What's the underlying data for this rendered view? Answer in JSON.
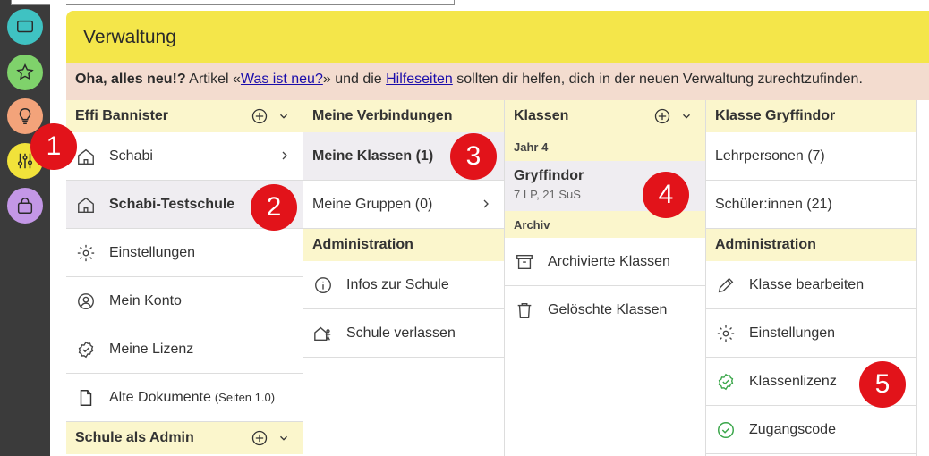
{
  "header": {
    "title": "Verwaltung"
  },
  "notice": {
    "lead": "Oha, alles neu!?",
    "t1": " Artikel «",
    "link1": "Was ist neu?",
    "t2": "» und die ",
    "link2": "Hilfeseiten",
    "t3": " sollten dir helfen, dich in der neuen Verwaltung zurechtzufinden."
  },
  "col1": {
    "title": "Effi Bannister",
    "items": [
      {
        "label": "Schabi"
      },
      {
        "label": "Schabi-Testschule"
      },
      {
        "label": "Einstellungen"
      },
      {
        "label": "Mein Konto"
      },
      {
        "label": "Meine Lizenz"
      },
      {
        "label": "Alte Dokumente",
        "suffix": "(Seiten 1.0)"
      }
    ],
    "footer_title": "Schule als Admin"
  },
  "col2": {
    "title": "Meine Verbindungen",
    "items": [
      {
        "label": "Meine Klassen (1)"
      },
      {
        "label": "Meine Gruppen (0)"
      }
    ],
    "admin_title": "Administration",
    "admin_items": [
      {
        "label": "Infos zur Schule"
      },
      {
        "label": "Schule verlassen"
      }
    ]
  },
  "col3": {
    "title": "Klassen",
    "year_label": "Jahr 4",
    "class_name": "Gryffindor",
    "class_meta": "7 LP, 21 SuS",
    "archive_label": "Archiv",
    "archive_items": [
      {
        "label": "Archivierte Klassen"
      },
      {
        "label": "Gelöschte Klassen"
      }
    ]
  },
  "col4": {
    "title": "Klasse Gryffindor",
    "items": [
      {
        "label": "Lehrpersonen (7)"
      },
      {
        "label": "Schüler:innen (21)"
      }
    ],
    "admin_title": "Administration",
    "admin_items": [
      {
        "label": "Klasse bearbeiten"
      },
      {
        "label": "Einstellungen"
      },
      {
        "label": "Klassenlizenz"
      },
      {
        "label": "Zugangscode"
      }
    ]
  },
  "badges": [
    "1",
    "2",
    "3",
    "4",
    "5"
  ],
  "colors": {
    "header_bg": "#f4e64a",
    "notice_bg": "#f3dccf",
    "section_bg": "#fbf6cc",
    "selected_bg": "#efedf1",
    "badge_red": "#e2131a",
    "rail_bg": "#3b3b3b",
    "rail_teal": "#3fc2c2",
    "rail_green": "#7fd26b",
    "rail_orange": "#f3a37a",
    "rail_yellow": "#f1e23a",
    "rail_purple": "#c397e6"
  },
  "icons": [
    "monitor-icon",
    "star-icon",
    "lightbulb-icon",
    "sliders-icon",
    "bag-icon",
    "plus-circle-icon",
    "chevron-down-icon",
    "house-icon",
    "gear-icon",
    "user-circle-icon",
    "badge-check-icon",
    "document-icon",
    "chevron-right-icon",
    "info-icon",
    "house-exit-icon",
    "archive-icon",
    "trash-icon",
    "pencil-icon",
    "check-circle-icon"
  ]
}
